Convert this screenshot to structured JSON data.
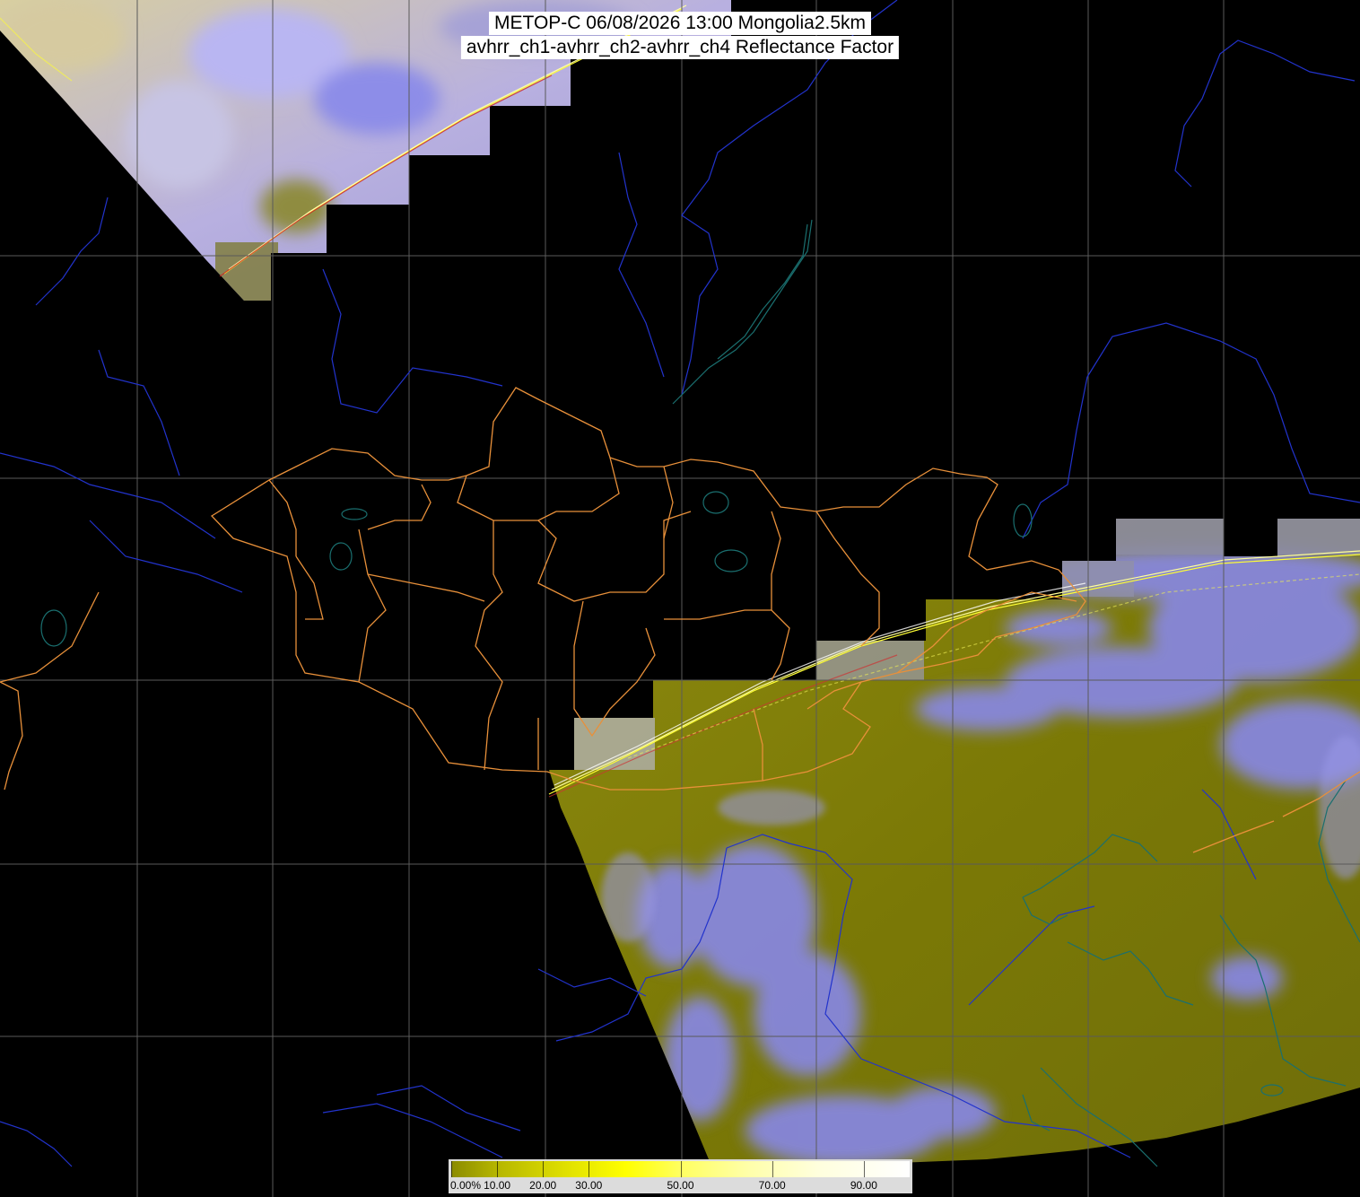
{
  "title": {
    "line1": "METOP-C 06/08/2026 13:00 Mongolia2.5km",
    "line2": "avhrr_ch1-avhrr_ch2-avhrr_ch4 Reflectance Factor"
  },
  "colorbar": {
    "labels": [
      "0.00%",
      "10.00",
      "20.00",
      "30.00",
      "50.00",
      "70.00",
      "90.00"
    ],
    "stops": [
      0,
      10,
      20,
      30,
      50,
      70,
      90
    ],
    "min": 0,
    "max": 100
  },
  "colors": {
    "background": "#000000",
    "graticule": "#5a5a5a",
    "rivers": "#2233cc",
    "coast_lakes": "#1a6f6f",
    "admin_borders": "#e8903a",
    "land_reflectance": "#7f7c08",
    "cloud": "#8c8cff",
    "scan_artifact": "#ffff33"
  },
  "icons": [
    "graticule-grid",
    "province-borders",
    "river-lines",
    "satellite-swath"
  ]
}
